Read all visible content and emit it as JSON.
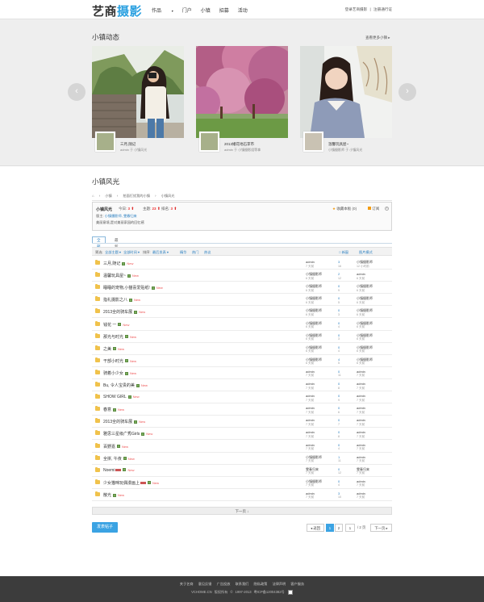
{
  "header": {
    "logo_main": "艺商",
    "logo_accent": "摄影",
    "nav": [
      "作品",
      "门户",
      "小镇",
      "招募",
      "活动"
    ],
    "dropdown_caret": "▾",
    "login": "登录艺商摄影",
    "separator": "|",
    "register": "注册通行证"
  },
  "gallery": {
    "title": "小镇动态",
    "more": "查看更多小镇 ▸",
    "prev": "‹",
    "next": "›",
    "cards": [
      {
        "title": "三月,随记",
        "meta": "admin 于 小镇风光"
      },
      {
        "title": "2013婚花地石李市",
        "meta": "admin 于 小镇摄影组等拿"
      },
      {
        "title": "温馨玩具屋~",
        "meta": "小镇摄影师 于 小镇风光"
      }
    ]
  },
  "forum": {
    "title": "小镇风光",
    "breadcrumb": [
      "⌂",
      "›",
      "小镇",
      "›",
      "拍面打扰我的小镇",
      "›",
      "小镇风光"
    ],
    "name": "小镇风光",
    "stats": [
      {
        "label": "今日: ",
        "value": "3"
      },
      {
        "label": "主题: ",
        "value": "23"
      },
      {
        "label": "排名: ",
        "value": "3"
      }
    ],
    "up_arrow": "⬆",
    "moderators_label": "版主: ",
    "moderators": "小镇摄影师, 雯春归来",
    "description": "美丽意境,是对美丽家园的回忆感",
    "favorite_star": "★",
    "favorite": "收藏本板 (0)",
    "rss": "订阅",
    "close": "×"
  },
  "tabs": [
    "全部",
    "最新(1)"
  ],
  "toolbar": {
    "filter_label": "筛选:",
    "filter_all": "全部主题 ▾",
    "filter_time": "全部时间 ▾",
    "sort_label": "排序:",
    "sort_latest": "最后发表 ▾",
    "hot": "精华",
    "heat": "热门",
    "digest": "热议",
    "new_window": "□ 新窗",
    "image_mode": "图片模式"
  },
  "threads": [
    {
      "title": "三月,随记",
      "img": true,
      "tag": false,
      "new": "New",
      "author": "admin",
      "a_time": "7 天前",
      "replies": "3",
      "views": "16",
      "last": "小镇摄影师",
      "l_time": "12 小时前"
    },
    {
      "title": "温馨玩具屋~",
      "img": true,
      "tag": false,
      "new": "New",
      "author": "小镇摄影师",
      "a_time": "6 天前",
      "replies": "2",
      "views": "12",
      "last": "admin",
      "l_time": "6 天前"
    },
    {
      "title": "睡睡的宠物,小猫喜爱贴纸!",
      "img": true,
      "tag": false,
      "new": "New",
      "author": "小镇摄影师",
      "a_time": "6 天前",
      "replies": "0",
      "views": "9",
      "last": "小镇摄影师",
      "l_time": "6 天前"
    },
    {
      "title": "指礼摄影之八",
      "img": true,
      "tag": false,
      "new": "New",
      "author": "小镇摄影师",
      "a_time": "6 天前",
      "replies": "0",
      "views": "5",
      "last": "小镇摄影师",
      "l_time": "6 天前"
    },
    {
      "title": "2013全的骑车展",
      "img": true,
      "tag": false,
      "new": "New",
      "author": "小镇摄影师",
      "a_time": "6 天前",
      "replies": "0",
      "views": "3",
      "last": "小镇摄影师",
      "l_time": "6 天前"
    },
    {
      "title": "钱花 一",
      "img": true,
      "tag": false,
      "new": "New",
      "author": "小镇摄影师",
      "a_time": "6 天前",
      "replies": "0",
      "views": "4",
      "last": "小镇摄影师",
      "l_time": "6 天前"
    },
    {
      "title": "那光与时光",
      "img": true,
      "tag": false,
      "new": "New",
      "author": "小镇摄影师",
      "a_time": "6 天前",
      "replies": "0",
      "views": "3",
      "last": "小镇摄影师",
      "l_time": "6 天前"
    },
    {
      "title": "之美",
      "img": true,
      "tag": false,
      "new": "New",
      "author": "小镇摄影师",
      "a_time": "6 天前",
      "replies": "0",
      "views": "4",
      "last": "小镇摄影师",
      "l_time": "6 天前"
    },
    {
      "title": "干部小时光",
      "img": true,
      "tag": false,
      "new": "New",
      "author": "小镇摄影师",
      "a_time": "6 天前",
      "replies": "4",
      "views": "5",
      "last": "小镇摄影师",
      "l_time": "6 天前"
    },
    {
      "title": "骑着小少女",
      "img": true,
      "tag": false,
      "new": "New",
      "author": "admin",
      "a_time": "7 天前",
      "replies": "0",
      "views": "11",
      "last": "admin",
      "l_time": "7 天前"
    },
    {
      "title": "Bu, 令人宝贵的美",
      "img": true,
      "tag": false,
      "new": "New",
      "author": "admin",
      "a_time": "7 天前",
      "replies": "0",
      "views": "8",
      "last": "admin",
      "l_time": "7 天前"
    },
    {
      "title": "SHOW GIRL",
      "img": true,
      "tag": false,
      "new": "New",
      "author": "admin",
      "a_time": "7 天前",
      "replies": "0",
      "views": "9",
      "last": "admin",
      "l_time": "7 天前"
    },
    {
      "title": "春意",
      "img": true,
      "tag": false,
      "new": "New",
      "author": "admin",
      "a_time": "7 天前",
      "replies": "0",
      "views": "6",
      "last": "admin",
      "l_time": "7 天前"
    },
    {
      "title": "2013全的骑车展",
      "img": true,
      "tag": false,
      "new": "New",
      "author": "admin",
      "a_time": "7 天前",
      "replies": "0",
      "views": "7",
      "last": "admin",
      "l_time": "7 天前"
    },
    {
      "title": "雅思三星级广秀Girls",
      "img": true,
      "tag": false,
      "new": "New",
      "author": "admin",
      "a_time": "7 天前",
      "replies": "0",
      "views": "8",
      "last": "admin",
      "l_time": "7 天前"
    },
    {
      "title": "百野嘉",
      "img": true,
      "tag": false,
      "new": "New",
      "author": "admin",
      "a_time": "7 天前",
      "replies": "0",
      "views": "4",
      "last": "admin",
      "l_time": "7 天前"
    },
    {
      "title": "全拼, 午夜",
      "img": true,
      "tag": false,
      "new": "New",
      "author": "小镇摄影师",
      "a_time": "7 天前",
      "replies": "1",
      "views": "11",
      "last": "admin",
      "l_time": "7 天前"
    },
    {
      "title": "Noemi",
      "img": true,
      "tag": true,
      "new": "New",
      "author": "雯春归来",
      "a_time": "7 天前",
      "replies": "0",
      "views": "12",
      "last": "雯春归来",
      "l_time": "7 天前"
    },
    {
      "title": "少女猫咪玩偶漫画上",
      "img": true,
      "tag": true,
      "new": "New",
      "author": "小镇摄影师",
      "a_time": "7 天前",
      "replies": "0",
      "views": "4",
      "last": "admin",
      "l_time": "7 天前"
    },
    {
      "title": "散光",
      "img": true,
      "tag": false,
      "new": "New",
      "author": "admin",
      "a_time": "7 天前",
      "replies": "3",
      "views": "10",
      "last": "admin",
      "l_time": "7 天前"
    }
  ],
  "pagination": {
    "next_page": "下一页 ↓",
    "post_button": "发表帖子",
    "prev_label": "◂ 返回",
    "pages": [
      "1",
      "2"
    ],
    "page_input": "1",
    "total": "/ 2 页",
    "next_label": "下一页 ▸"
  },
  "footer": {
    "links": [
      "关于艺商",
      "意见反馈",
      "广告投放",
      "联系我们",
      "隐私政策",
      "法律声明",
      "客户服务"
    ],
    "copyright": [
      "VCHOME.CN",
      "版权所有",
      "©",
      "1997-2013",
      "粤ICP备12004382号"
    ]
  },
  "colors": {
    "accent": "#3ba3e3",
    "link": "#2a7fc0",
    "new": "#e55555",
    "footer": "#3c3c3c"
  }
}
